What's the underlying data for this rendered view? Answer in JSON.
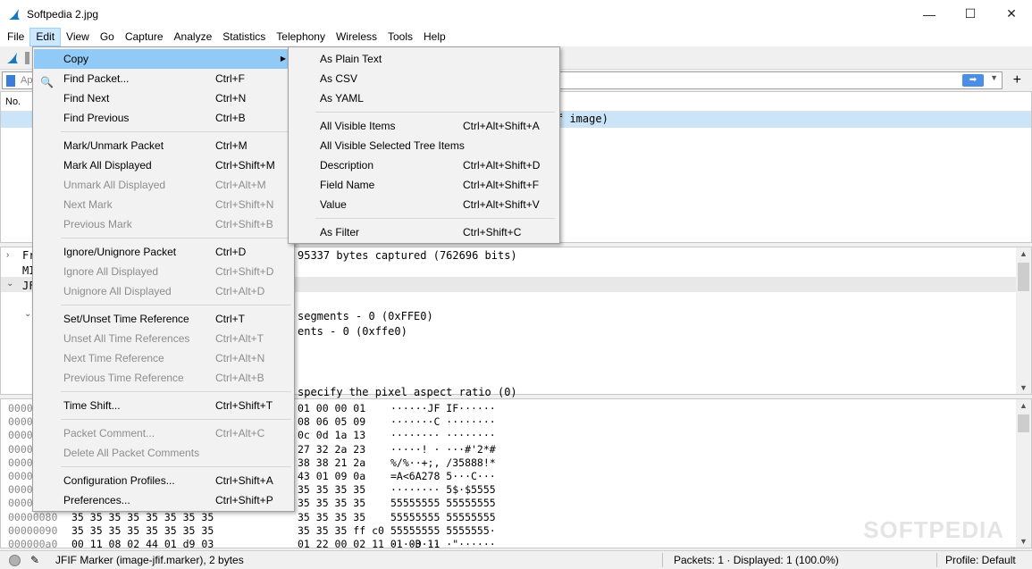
{
  "window": {
    "title": "Softpedia 2.jpg",
    "minimize_glyph": "—",
    "maximize_glyph": "☐",
    "close_glyph": "✕"
  },
  "menubar": [
    "File",
    "Edit",
    "View",
    "Go",
    "Capture",
    "Analyze",
    "Statistics",
    "Telephony",
    "Wireless",
    "Tools",
    "Help"
  ],
  "filter": {
    "placeholder": "Ap",
    "plus": "+"
  },
  "packet_list": {
    "header_no": "No.",
    "row_info": "f image)"
  },
  "details": {
    "lines": [
      "95337 bytes captured (762696 bits)",
      "segments - 0 (0xFFE0)",
      "ents - 0 (0xffe0)",
      "specify the pixel aspect ratio (0)"
    ],
    "left_labels": [
      "Fr",
      "MI",
      "JF"
    ]
  },
  "bytes": {
    "offsets": [
      "0000",
      "0000",
      "0000",
      "0000",
      "0000",
      "0000",
      "0000",
      "0000",
      "00000080",
      "00000090",
      "000000a0"
    ],
    "left_hex": [
      "",
      "",
      "",
      "",
      "",
      "",
      "",
      "",
      "35 35 35 35 35 35 35 35",
      "35 35 35 35 35 35 35 35",
      "00 11 08 02 44 01 d9 03"
    ],
    "right_hex": [
      "01 00 00 01",
      "08 06 05 09",
      "0c 0d 1a 13",
      "27 32 2a 23",
      "38 38 21 2a",
      "43 01 09 0a",
      "35 35 35 35",
      "35 35 35 35",
      "35 35 35 35",
      "35 35 35 ff c0",
      "01 22 00 02 11 01 03 11"
    ],
    "ascii": [
      "······JF IF······",
      "·······C ········",
      "········ ········",
      "·····! · ···#'2*#",
      "%/%··+;, /35888!*",
      "=A<6A278 5···C···",
      "········ 5$·$5555",
      "55555555 55555555",
      "55555555 55555555",
      "55555555 5555555·",
      "····D··· ·\"······"
    ]
  },
  "statusbar": {
    "field": "JFIF Marker (image-jfif.marker), 2 bytes",
    "packets": "Packets: 1 · Displayed: 1 (100.0%)",
    "profile": "Profile: Default"
  },
  "watermark": "SOFTPEDIA",
  "edit_menu": [
    {
      "label": "Copy",
      "shortcut": "",
      "disabled": false,
      "submenu": true,
      "highlight": true
    },
    {
      "label": "Find Packet...",
      "shortcut": "Ctrl+F",
      "disabled": false
    },
    {
      "label": "Find Next",
      "shortcut": "Ctrl+N",
      "disabled": false
    },
    {
      "label": "Find Previous",
      "shortcut": "Ctrl+B",
      "disabled": false
    },
    {
      "sep": true
    },
    {
      "label": "Mark/Unmark Packet",
      "shortcut": "Ctrl+M",
      "disabled": false
    },
    {
      "label": "Mark All Displayed",
      "shortcut": "Ctrl+Shift+M",
      "disabled": false
    },
    {
      "label": "Unmark All Displayed",
      "shortcut": "Ctrl+Alt+M",
      "disabled": true
    },
    {
      "label": "Next Mark",
      "shortcut": "Ctrl+Shift+N",
      "disabled": true
    },
    {
      "label": "Previous Mark",
      "shortcut": "Ctrl+Shift+B",
      "disabled": true
    },
    {
      "sep": true
    },
    {
      "label": "Ignore/Unignore Packet",
      "shortcut": "Ctrl+D",
      "disabled": false
    },
    {
      "label": "Ignore All Displayed",
      "shortcut": "Ctrl+Shift+D",
      "disabled": true
    },
    {
      "label": "Unignore All Displayed",
      "shortcut": "Ctrl+Alt+D",
      "disabled": true
    },
    {
      "sep": true
    },
    {
      "label": "Set/Unset Time Reference",
      "shortcut": "Ctrl+T",
      "disabled": false
    },
    {
      "label": "Unset All Time References",
      "shortcut": "Ctrl+Alt+T",
      "disabled": true
    },
    {
      "label": "Next Time Reference",
      "shortcut": "Ctrl+Alt+N",
      "disabled": true
    },
    {
      "label": "Previous Time Reference",
      "shortcut": "Ctrl+Alt+B",
      "disabled": true
    },
    {
      "sep": true
    },
    {
      "label": "Time Shift...",
      "shortcut": "Ctrl+Shift+T",
      "disabled": false
    },
    {
      "sep": true
    },
    {
      "label": "Packet Comment...",
      "shortcut": "Ctrl+Alt+C",
      "disabled": true
    },
    {
      "label": "Delete All Packet Comments",
      "shortcut": "",
      "disabled": true
    },
    {
      "sep": true
    },
    {
      "label": "Configuration Profiles...",
      "shortcut": "Ctrl+Shift+A",
      "disabled": false
    },
    {
      "label": "Preferences...",
      "shortcut": "Ctrl+Shift+P",
      "disabled": false
    }
  ],
  "copy_menu": [
    {
      "label": "As Plain Text",
      "shortcut": ""
    },
    {
      "label": "As CSV",
      "shortcut": ""
    },
    {
      "label": "As YAML",
      "shortcut": ""
    },
    {
      "sep": true
    },
    {
      "label": "All Visible Items",
      "shortcut": "Ctrl+Alt+Shift+A"
    },
    {
      "label": "All Visible Selected Tree Items",
      "shortcut": ""
    },
    {
      "label": "Description",
      "shortcut": "Ctrl+Alt+Shift+D"
    },
    {
      "label": "Field Name",
      "shortcut": "Ctrl+Alt+Shift+F"
    },
    {
      "label": "Value",
      "shortcut": "Ctrl+Alt+Shift+V"
    },
    {
      "sep": true
    },
    {
      "label": "As Filter",
      "shortcut": "Ctrl+Shift+C"
    }
  ],
  "colors": {
    "menu_highlight": "#91c9f7",
    "menubar_active": "#cce8ff",
    "selected_row": "#cce4f7"
  }
}
